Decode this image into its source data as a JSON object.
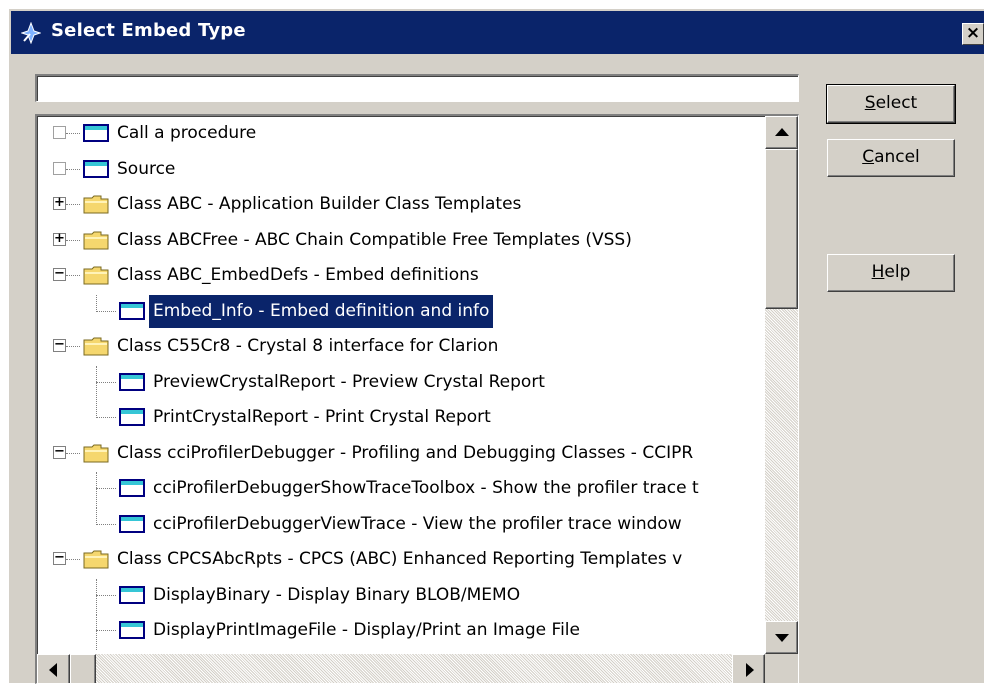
{
  "dialog": {
    "title": "Select Embed Type",
    "close_glyph": "×",
    "title_icon": "embed-wizard-icon"
  },
  "search": {
    "value": "",
    "placeholder": ""
  },
  "buttons": {
    "select": {
      "mnemonic": "S",
      "rest": "elect"
    },
    "cancel": {
      "mnemonic": "C",
      "rest": "ancel"
    },
    "help": {
      "mnemonic": "H",
      "rest": "elp"
    }
  },
  "tree": {
    "items": [
      {
        "label": "Call a procedure",
        "level": 0,
        "kind": "leaf-root",
        "icon": "embed-leaf-icon"
      },
      {
        "label": "Source",
        "level": 0,
        "kind": "leaf-root",
        "icon": "embed-leaf-icon"
      },
      {
        "label": "Class ABC - Application Builder Class Templates",
        "level": 0,
        "kind": "collapsed",
        "icon": "folder-icon"
      },
      {
        "label": "Class ABCFree - ABC Chain Compatible Free Templates (VSS)",
        "level": 0,
        "kind": "collapsed",
        "icon": "folder-icon"
      },
      {
        "label": "Class ABC_EmbedDefs - Embed definitions",
        "level": 0,
        "kind": "expanded",
        "icon": "folder-icon"
      },
      {
        "label": "Embed_Info - Embed definition and info",
        "level": 1,
        "kind": "child",
        "icon": "embed-leaf-icon",
        "selected": true,
        "last": true
      },
      {
        "label": "Class C55Cr8 - Crystal 8 interface for Clarion",
        "level": 0,
        "kind": "expanded",
        "icon": "folder-icon"
      },
      {
        "label": "PreviewCrystalReport - Preview Crystal Report",
        "level": 1,
        "kind": "child",
        "icon": "embed-leaf-icon"
      },
      {
        "label": "PrintCrystalReport - Print Crystal Report",
        "level": 1,
        "kind": "child",
        "icon": "embed-leaf-icon",
        "last": true
      },
      {
        "label": "Class cciProfilerDebugger - Profiling and Debugging Classes - CCIPR",
        "level": 0,
        "kind": "expanded",
        "icon": "folder-icon"
      },
      {
        "label": "cciProfilerDebuggerShowTraceToolbox - Show the profiler trace t",
        "level": 1,
        "kind": "child",
        "icon": "embed-leaf-icon"
      },
      {
        "label": "cciProfilerDebuggerViewTrace - View the profiler trace window",
        "level": 1,
        "kind": "child",
        "icon": "embed-leaf-icon",
        "last": true
      },
      {
        "label": "Class CPCSAbcRpts - CPCS (ABC) Enhanced Reporting Templates v",
        "level": 0,
        "kind": "expanded",
        "icon": "folder-icon"
      },
      {
        "label": "DisplayBinary - Display Binary BLOB/MEMO",
        "level": 1,
        "kind": "child",
        "icon": "embed-leaf-icon"
      },
      {
        "label": "DisplayPrintImageFile - Display/Print an Image File",
        "level": 1,
        "kind": "child",
        "icon": "embed-leaf-icon"
      }
    ]
  },
  "colors": {
    "titlebar": "#0a246a",
    "selection": "#0a246a",
    "face": "#d4d0c8",
    "folder": "#f5d76e",
    "embed_icon_accent": "#36c6d6"
  }
}
